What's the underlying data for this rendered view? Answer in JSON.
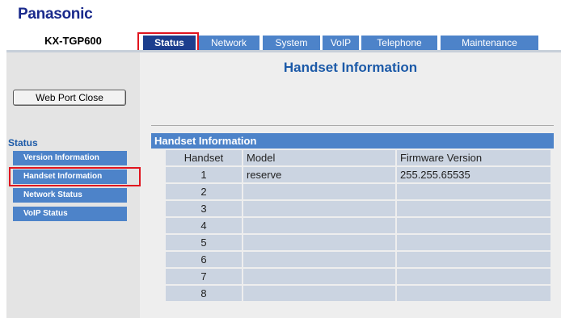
{
  "brand": {
    "logo": "Panasonic",
    "model": "KX-TGP600"
  },
  "tabs": [
    {
      "label": "Status",
      "active": true
    },
    {
      "label": "Network",
      "active": false
    },
    {
      "label": "System",
      "active": false
    },
    {
      "label": "VoIP",
      "active": false
    },
    {
      "label": "Telephone",
      "active": false
    },
    {
      "label": "Maintenance",
      "active": false
    }
  ],
  "sidebar": {
    "web_port_button": "Web Port Close",
    "section_title": "Status",
    "items": [
      {
        "label": "Version Information"
      },
      {
        "label": "Handset Information"
      },
      {
        "label": "Network Status"
      },
      {
        "label": "VoIP Status"
      }
    ]
  },
  "main": {
    "title": "Handset Information",
    "table": {
      "heading": "Handset Information",
      "columns": [
        "Handset",
        "Model",
        "Firmware Version"
      ],
      "rows": [
        [
          "1",
          "reserve",
          "255.255.65535"
        ],
        [
          "2",
          "",
          ""
        ],
        [
          "3",
          "",
          ""
        ],
        [
          "4",
          "",
          ""
        ],
        [
          "5",
          "",
          ""
        ],
        [
          "6",
          "",
          ""
        ],
        [
          "7",
          "",
          ""
        ],
        [
          "8",
          "",
          ""
        ]
      ]
    }
  },
  "colors": {
    "brand": "#1a2a8c",
    "accent": "#4d83c9",
    "active_tab": "#1c3e8e",
    "highlight": "#e0141e"
  }
}
